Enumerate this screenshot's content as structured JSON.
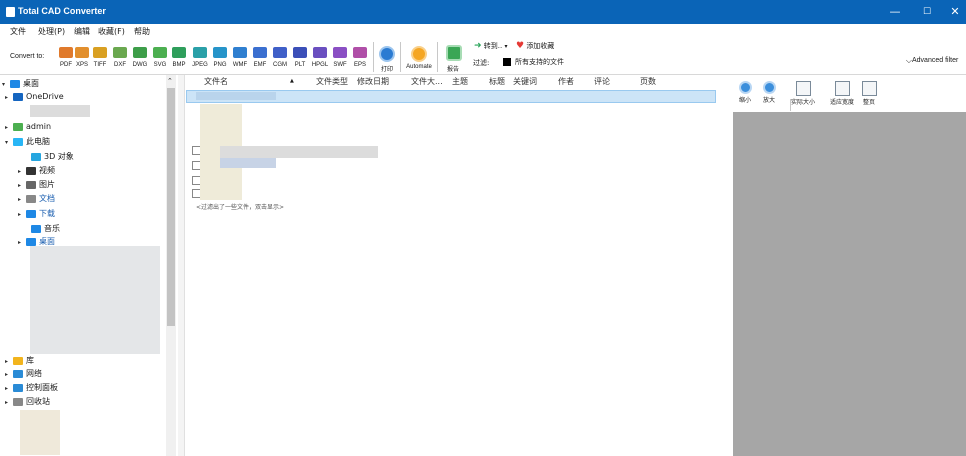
{
  "window": {
    "title": "Total CAD Converter",
    "min": "—",
    "max": "☐",
    "close": "✕"
  },
  "behind_text": {
    "a": "…",
    "b": "…"
  },
  "menu": [
    "文件",
    "处理(P)",
    "编辑",
    "收藏(F)",
    "帮助"
  ],
  "toolbar": {
    "convert_label": "Convert to:",
    "formats": [
      {
        "id": "pdf",
        "label": "PDF",
        "color": "#e07a2c"
      },
      {
        "id": "xps",
        "label": "XPS",
        "color": "#e28f2d"
      },
      {
        "id": "tiff",
        "label": "TIFF",
        "color": "#d9a022"
      },
      {
        "id": "dxf",
        "label": "DXF",
        "color": "#6aa84f"
      },
      {
        "id": "dwg",
        "label": "DWG",
        "color": "#3d9e49"
      },
      {
        "id": "svg",
        "label": "SVG",
        "color": "#4caf50"
      },
      {
        "id": "bmp",
        "label": "BMP",
        "color": "#2e9e5b"
      },
      {
        "id": "jpeg",
        "label": "JPEG",
        "color": "#2aa0a8"
      },
      {
        "id": "png",
        "label": "PNG",
        "color": "#2694c9"
      },
      {
        "id": "wmf",
        "label": "WMF",
        "color": "#2f7fd0"
      },
      {
        "id": "emf",
        "label": "EMF",
        "color": "#3a6fd0"
      },
      {
        "id": "cgm",
        "label": "CGM",
        "color": "#3f5fc8"
      },
      {
        "id": "plt",
        "label": "PLT",
        "color": "#3b4fb8"
      },
      {
        "id": "hpgl",
        "label": "HPGL",
        "color": "#6a4fc0"
      },
      {
        "id": "swf",
        "label": "SWF",
        "color": "#8a4fc4"
      },
      {
        "id": "eps",
        "label": "EPS",
        "color": "#b04fa8"
      }
    ],
    "print_label": "打印",
    "automate_label": "Automate",
    "report_label": "报告",
    "convert_to_label": "转到..",
    "add_fav_label": "添加收藏",
    "filter_label": "过滤:",
    "filter_value": "所有支持的文件",
    "advanced_filter": "Advanced filter",
    "dropdown_arrow": "⌵"
  },
  "tree": {
    "items": [
      {
        "label": "桌面",
        "icon": "desktop-icon",
        "color": "#1e88e5",
        "expanded": "▾"
      },
      {
        "label": "OneDrive",
        "icon": "cloud-icon",
        "color": "#1565c0",
        "expanded": "▸"
      },
      {
        "label": "admin",
        "icon": "user-icon",
        "color": "#4caf50",
        "expanded": "▸"
      },
      {
        "label": "此电脑",
        "icon": "computer-icon",
        "color": "#29b6f6",
        "expanded": "▾"
      },
      {
        "label": "3D 对象",
        "icon": "cube-icon",
        "color": "#26a6e0",
        "expanded": ""
      },
      {
        "label": "视频",
        "icon": "video-icon",
        "color": "#333",
        "expanded": "▸"
      },
      {
        "label": "图片",
        "icon": "picture-icon",
        "color": "#666",
        "expanded": "▸"
      },
      {
        "label": "文档",
        "icon": "document-icon",
        "color": "#888",
        "expanded": "▸"
      },
      {
        "label": "下载",
        "icon": "download-icon",
        "color": "#1e88e5",
        "expanded": "▸"
      },
      {
        "label": "音乐",
        "icon": "music-icon",
        "color": "#1e88e5",
        "expanded": ""
      },
      {
        "label": "桌面",
        "icon": "desktop-icon",
        "color": "#1e88e5",
        "expanded": "▸"
      },
      {
        "label": "库",
        "icon": "library-icon",
        "color": "#f2b41d",
        "expanded": "▸"
      },
      {
        "label": "网络",
        "icon": "network-icon",
        "color": "#2a8bd6",
        "expanded": "▸"
      },
      {
        "label": "控制面板",
        "icon": "control-panel-icon",
        "color": "#2a8bd6",
        "expanded": "▸"
      },
      {
        "label": "回收站",
        "icon": "recycle-bin-icon",
        "color": "#888",
        "expanded": "▸"
      }
    ],
    "scroll_up": "⌃"
  },
  "columns": [
    "文件名",
    "文件类型",
    "修改日期",
    "文件大...",
    "主题",
    "标题",
    "关键词",
    "作者",
    "评论",
    "页数"
  ],
  "sort_indicator": "▲",
  "hint": "<过滤出了一些文件，双击显示>",
  "preview": {
    "buttons": [
      {
        "label": "缩小",
        "icon": "zoom-out-icon"
      },
      {
        "label": "放大",
        "icon": "zoom-in-icon"
      },
      {
        "label": "实际大小",
        "icon": "actual-size-icon"
      },
      {
        "label": "适应宽度",
        "icon": "fit-width-icon"
      },
      {
        "label": "整页",
        "icon": "full-page-icon"
      }
    ]
  }
}
